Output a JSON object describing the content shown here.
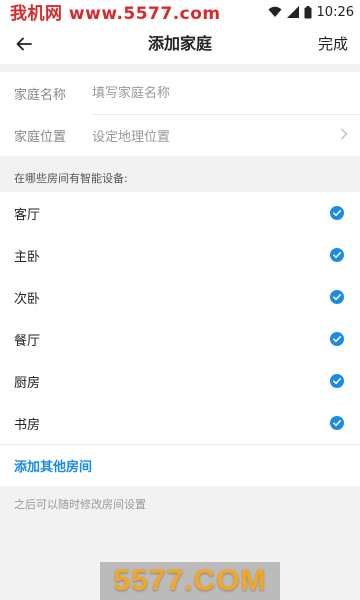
{
  "status_bar": {
    "watermark": "我机网 www.5577.com",
    "time": "10:26",
    "icons": [
      "wifi-icon",
      "signal-icon",
      "battery-icon"
    ]
  },
  "nav": {
    "title": "添加家庭",
    "done_label": "完成",
    "back_icon": "arrow-left-icon"
  },
  "form": {
    "name_label": "家庭名称",
    "name_placeholder": "填写家庭名称",
    "location_label": "家庭位置",
    "location_value": "设定地理位置"
  },
  "rooms": {
    "hint": "在哪些房间有智能设备:",
    "items": [
      {
        "name": "客厅",
        "checked": true
      },
      {
        "name": "主卧",
        "checked": true
      },
      {
        "name": "次卧",
        "checked": true
      },
      {
        "name": "餐厅",
        "checked": true
      },
      {
        "name": "厨房",
        "checked": true
      },
      {
        "name": "书房",
        "checked": true
      }
    ],
    "add_label": "添加其他房间"
  },
  "footer_hint": "之后可以随时修改房间设置",
  "bottom_watermark": "5577.COM",
  "colors": {
    "accent": "#1a8be6",
    "watermark_red": "#d92b2b",
    "watermark_orange": "#f5a623"
  }
}
